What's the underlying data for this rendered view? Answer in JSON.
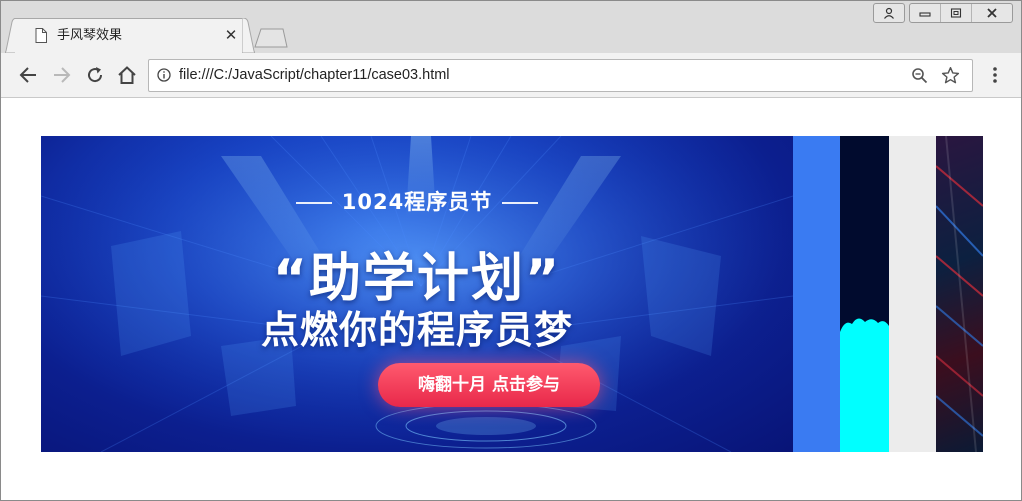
{
  "browser": {
    "tab": {
      "title": "手风琴效果"
    },
    "address_bar": {
      "url": "file:///C:/JavaScript/chapter11/case03.html"
    }
  },
  "banner": {
    "subtitle": "1024程序员节",
    "title": "“助学计划”",
    "tagline": "点燃你的程序员梦",
    "cta_label": "嗨翻十月 点击参与"
  },
  "colors": {
    "banner_blue": "#1744c8",
    "panel2": "#3a7bf2",
    "panel3": "#010b2e",
    "panel3_accent": "#00ffff",
    "panel4": "#ececec",
    "cta": "#e8284a"
  }
}
